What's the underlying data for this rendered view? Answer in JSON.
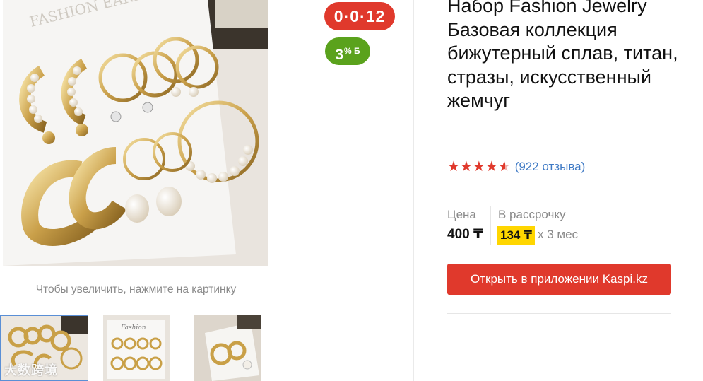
{
  "gallery": {
    "card_brand_text": "FASHION EARRINGS",
    "thumb2_brand_text": "Fashion",
    "zoom_hint": "Чтобы увеличить, нажмите на картинку",
    "watermark": "大数跨境"
  },
  "badges": {
    "installment": "0·0·12",
    "bonus_value": "3",
    "bonus_sup": "% Б"
  },
  "product": {
    "title": "Набор Fashion Jewelry Базовая коллекция бижутерный сплав, титан, стразы, искусственный жемчуг",
    "rating_value": 4.5,
    "rating_max": 5,
    "reviews": "(922 отзыва)",
    "price_label": "Цена",
    "price": "400 ₸",
    "installment_label": "В рассрочку",
    "installment_amount": "134 ₸",
    "installment_term": "x 3 мес",
    "cta_label": "Открыть в приложении Kaspi.kz"
  },
  "colors": {
    "brand_red": "#e0392c",
    "bonus_green": "#5aa21c",
    "installment_yellow": "#ffd600",
    "link_blue": "#3f7ac5"
  }
}
